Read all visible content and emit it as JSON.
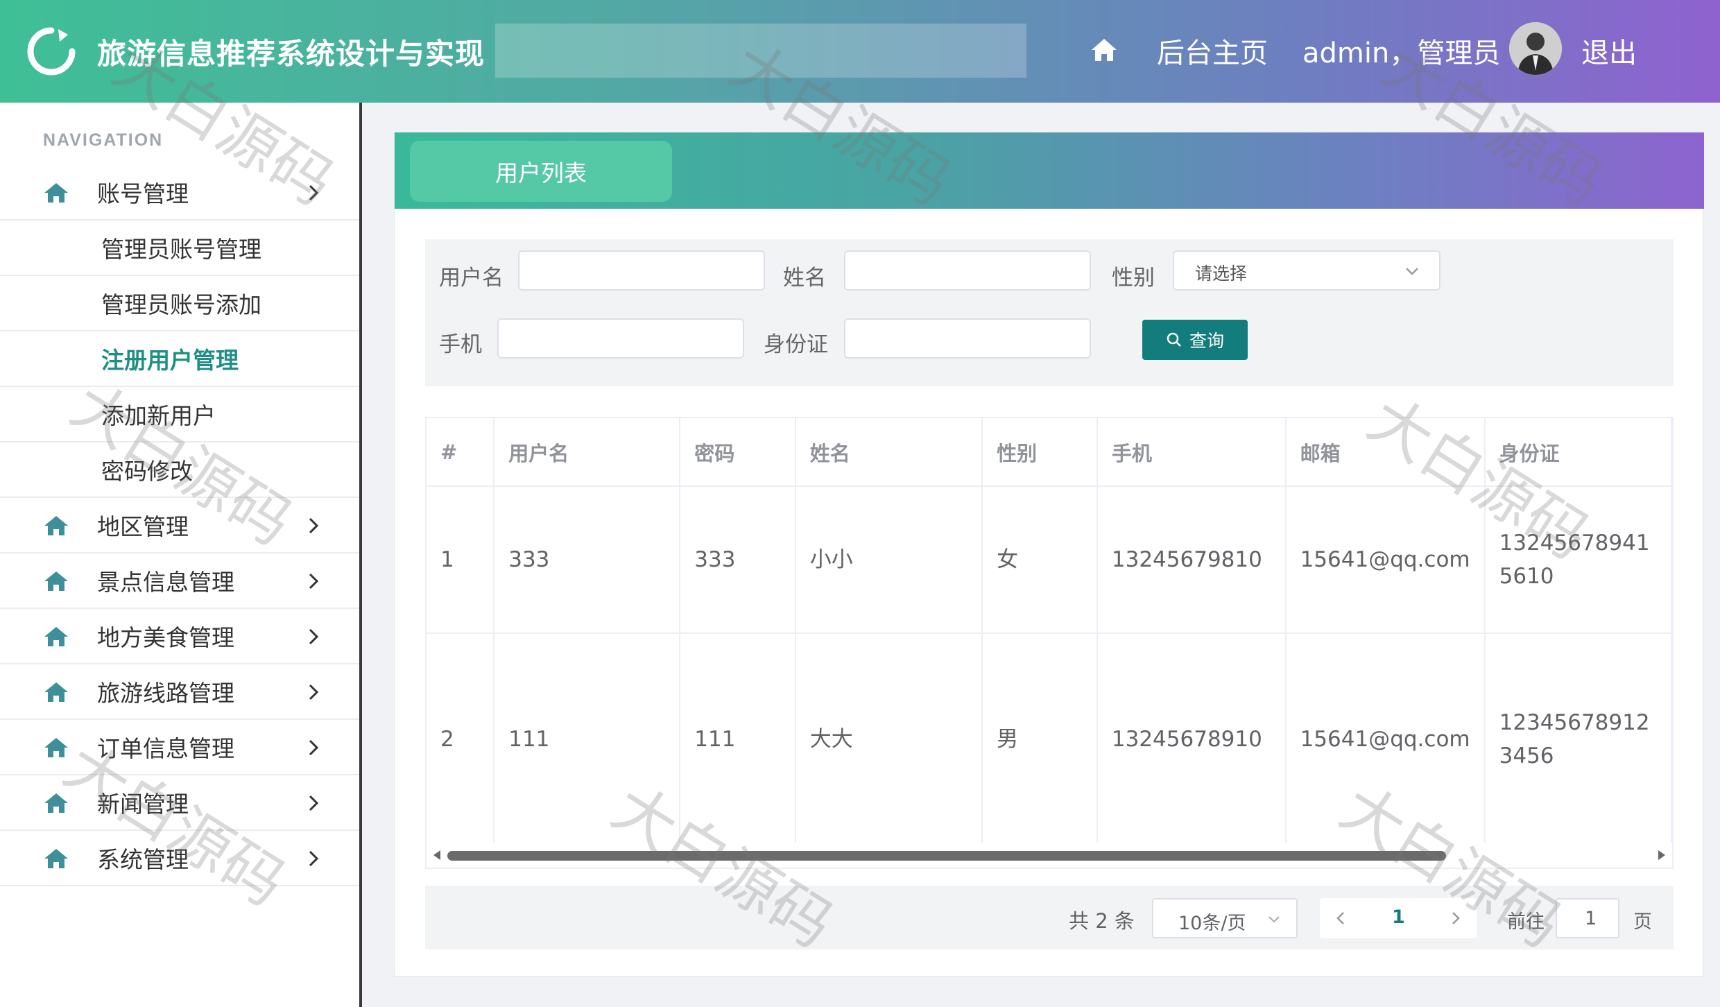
{
  "header": {
    "title": "旅游信息推荐系统设计与实现",
    "home_label": "后台主页",
    "user_label": "admin，管理员",
    "logout_label": "退出"
  },
  "sidebar": {
    "caption": "NAVIGATION",
    "items": [
      {
        "label": "账号管理",
        "type": "group"
      },
      {
        "label": "管理员账号管理",
        "type": "sub"
      },
      {
        "label": "管理员账号添加",
        "type": "sub"
      },
      {
        "label": "注册用户管理",
        "type": "sub",
        "active": true
      },
      {
        "label": "添加新用户",
        "type": "sub"
      },
      {
        "label": "密码修改",
        "type": "sub"
      },
      {
        "label": "地区管理",
        "type": "group"
      },
      {
        "label": "景点信息管理",
        "type": "group"
      },
      {
        "label": "地方美食管理",
        "type": "group"
      },
      {
        "label": "旅游线路管理",
        "type": "group"
      },
      {
        "label": "订单信息管理",
        "type": "group"
      },
      {
        "label": "新闻管理",
        "type": "group"
      },
      {
        "label": "系统管理",
        "type": "group"
      }
    ]
  },
  "panel": {
    "tab_label": "用户列表"
  },
  "search": {
    "username_label": "用户名",
    "name_label": "姓名",
    "gender_label": "性别",
    "gender_placeholder": "请选择",
    "phone_label": "手机",
    "idcard_label": "身份证",
    "query_label": "查询"
  },
  "table": {
    "headers": [
      "#",
      "用户名",
      "密码",
      "姓名",
      "性别",
      "手机",
      "邮箱",
      "身份证"
    ],
    "rows": [
      [
        "1",
        "333",
        "333",
        "小小",
        "女",
        "13245679810",
        "15641@qq.com",
        "132456789415610"
      ],
      [
        "2",
        "111",
        "111",
        "大大",
        "男",
        "13245678910",
        "15641@qq.com",
        "123456789123456"
      ]
    ]
  },
  "pagination": {
    "total": "共 2 条",
    "page_size": "10条/页",
    "current": "1",
    "goto_label": "前往",
    "goto_value": "1",
    "page_suffix": "页"
  },
  "watermark": "大白源码",
  "colors": {
    "accent": "#137d7d",
    "header_start": "#3fbf96",
    "header_end": "#8f62cf"
  }
}
